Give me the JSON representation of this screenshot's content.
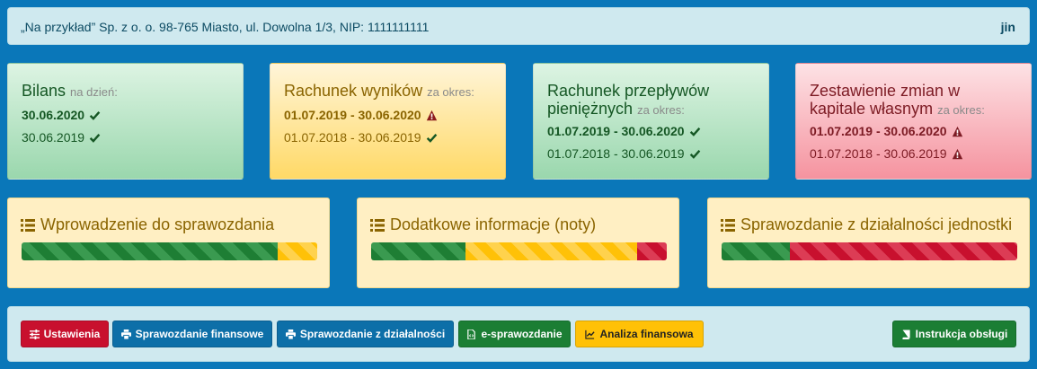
{
  "header": {
    "company": "„Na przykład” Sp. z o. o. 98-765 Miasto, ul. Dowolna 1/3, NIP: 1111111111",
    "user": "jin"
  },
  "cards": [
    {
      "title": "Bilans",
      "period_label": "na dzień:",
      "status_color": "green",
      "lines": [
        {
          "text": "30.06.2020",
          "icon": "check-icon",
          "bold": true
        },
        {
          "text": "30.06.2019",
          "icon": "check-icon",
          "bold": false
        }
      ]
    },
    {
      "title": "Rachunek wyników",
      "period_label": "za okres:",
      "status_color": "yellow",
      "lines": [
        {
          "text": "01.07.2019 - 30.06.2020",
          "icon": "warning-icon",
          "bold": true
        },
        {
          "text": "01.07.2018 - 30.06.2019",
          "icon": "check-icon",
          "bold": false
        }
      ]
    },
    {
      "title": "Rachunek przepływów pieniężnych",
      "period_label": "za okres:",
      "status_color": "green",
      "lines": [
        {
          "text": "01.07.2019 - 30.06.2020",
          "icon": "check-icon",
          "bold": true
        },
        {
          "text": "01.07.2018 - 30.06.2019",
          "icon": "check-icon",
          "bold": false
        }
      ]
    },
    {
      "title": "Zestawienie zmian w kapitale własnym",
      "period_label": "za okres:",
      "status_color": "red",
      "lines": [
        {
          "text": "01.07.2019 - 30.06.2020",
          "icon": "warning-icon",
          "bold": true
        },
        {
          "text": "01.07.2018 - 30.06.2019",
          "icon": "warning-icon",
          "bold": false
        }
      ]
    }
  ],
  "progress_sections": [
    {
      "title": "Wprowadzenie do sprawozdania",
      "icon": "list-icon",
      "segments": [
        {
          "status": "green",
          "fraction": 0.865
        },
        {
          "status": "yellow",
          "fraction": 0.135
        }
      ]
    },
    {
      "title": "Dodatkowe informacje (noty)",
      "icon": "list-icon",
      "segments": [
        {
          "status": "green",
          "fraction": 0.32
        },
        {
          "status": "yellow",
          "fraction": 0.58
        },
        {
          "status": "red",
          "fraction": 0.1
        }
      ]
    },
    {
      "title": "Sprawozdanie z działalności jednostki",
      "icon": "list-icon",
      "segments": [
        {
          "status": "green",
          "fraction": 0.23
        },
        {
          "status": "red",
          "fraction": 0.77
        }
      ]
    }
  ],
  "actions": {
    "settings": "Ustawienia",
    "financial_report": "Sprawozdanie finansowe",
    "activity_report": "Sprawozdanie z działalności",
    "e_report": "e-sprawozdanie",
    "analysis": "Analiza finansowa",
    "manual": "Instrukcja obsługi"
  },
  "colors": {
    "background": "#0a77b9",
    "green": "#1e7e34",
    "yellow": "#ffc107",
    "red": "#c8102e",
    "blue_button": "#0d6fa8"
  }
}
